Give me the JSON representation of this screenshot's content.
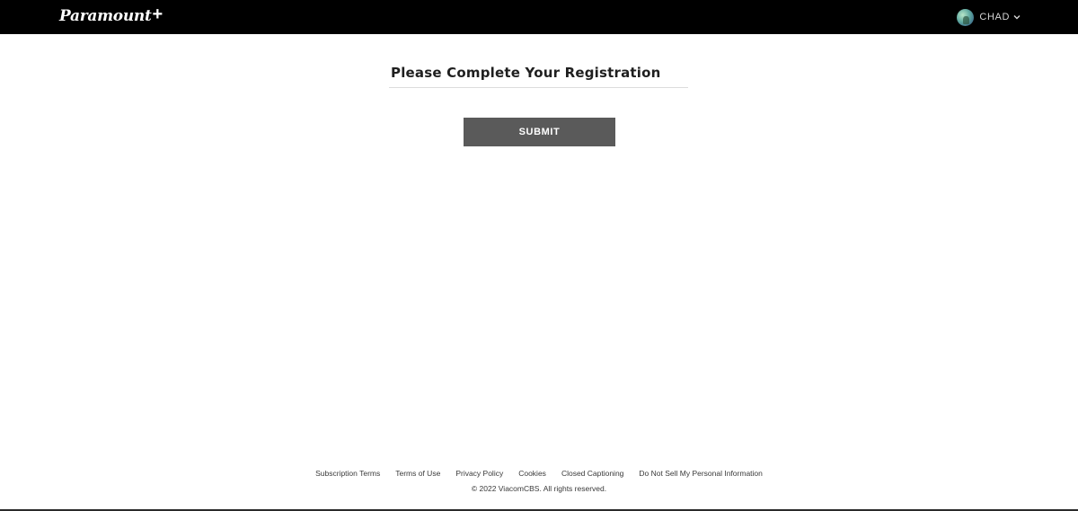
{
  "header": {
    "logo_text": "Paramount",
    "logo_plus": "+",
    "profile": {
      "name": "CHAD",
      "avatar_icon": "avatar-icon",
      "dropdown_icon": "chevron-down-icon"
    },
    "background_color": "#000000"
  },
  "main": {
    "title": "Please Complete Your Registration",
    "submit_label": "SUBMIT",
    "submit_color": "#5a5a5a"
  },
  "footer": {
    "links": [
      "Subscription Terms",
      "Terms of Use",
      "Privacy Policy",
      "Cookies",
      "Closed Captioning",
      "Do Not Sell My Personal Information"
    ],
    "copyright": "© 2022 ViacomCBS. All rights reserved."
  }
}
